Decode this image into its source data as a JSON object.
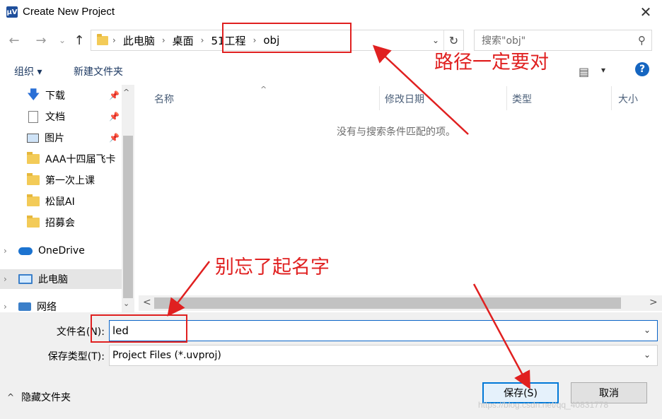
{
  "window": {
    "title": "Create New Project",
    "app_icon": "µV",
    "close_glyph": "✕"
  },
  "nav": {
    "back_glyph": "←",
    "forward_glyph": "→",
    "recent_glyph": "⌄",
    "up_glyph": "↑"
  },
  "address": {
    "crumbs": [
      "此电脑",
      "桌面",
      "51工程",
      "obj"
    ],
    "separator": "›",
    "dropdown_glyph": "⌄",
    "refresh_glyph": "↻"
  },
  "search": {
    "placeholder": "搜索\"obj\"",
    "icon_glyph": "⚲"
  },
  "toolbar": {
    "organize": "组织 ▾",
    "new_folder": "新建文件夹",
    "view_glyph": "▤",
    "view_drop": "▾",
    "help": "?"
  },
  "sidebar": {
    "pin_glyph": "📌",
    "expander_glyph": "›",
    "scroll_up": "^",
    "scroll_down": "⌄",
    "items": [
      {
        "label": "下载",
        "icon": "download-icon",
        "pinned": true
      },
      {
        "label": "文档",
        "icon": "document-icon",
        "pinned": true
      },
      {
        "label": "图片",
        "icon": "pictures-icon",
        "pinned": true
      },
      {
        "label": "AAA十四届飞卡",
        "icon": "folder-icon",
        "pinned": false
      },
      {
        "label": "第一次上课",
        "icon": "folder-icon",
        "pinned": false
      },
      {
        "label": "松鼠AI",
        "icon": "folder-icon",
        "pinned": false
      },
      {
        "label": "招募会",
        "icon": "folder-icon",
        "pinned": false
      },
      {
        "label": "OneDrive",
        "icon": "onedrive-icon",
        "pinned": false
      },
      {
        "label": "此电脑",
        "icon": "this-pc-icon",
        "pinned": false,
        "selected": true
      },
      {
        "label": "网络",
        "icon": "network-icon",
        "pinned": false
      }
    ]
  },
  "filelist": {
    "columns": [
      "名称",
      "修改日期",
      "类型",
      "大小"
    ],
    "sort_glyph": "^",
    "empty_message": "没有与搜索条件匹配的项。",
    "scroll_left": "<",
    "scroll_right": ">"
  },
  "form": {
    "filename_label": "文件名(N):",
    "filename_value": "led",
    "filetype_label": "保存类型(T):",
    "filetype_value": "Project Files (*.uvproj)",
    "dropdown_glyph": "⌄",
    "hide_folders": "隐藏文件夹",
    "hide_chevron": "^",
    "save": "保存(S)",
    "cancel": "取消"
  },
  "annotations": {
    "path_note": "路径一定要对",
    "name_note": "别忘了起名字",
    "color": "#e02020"
  },
  "watermark": "https://blog.csdn.net/qq_40831778"
}
